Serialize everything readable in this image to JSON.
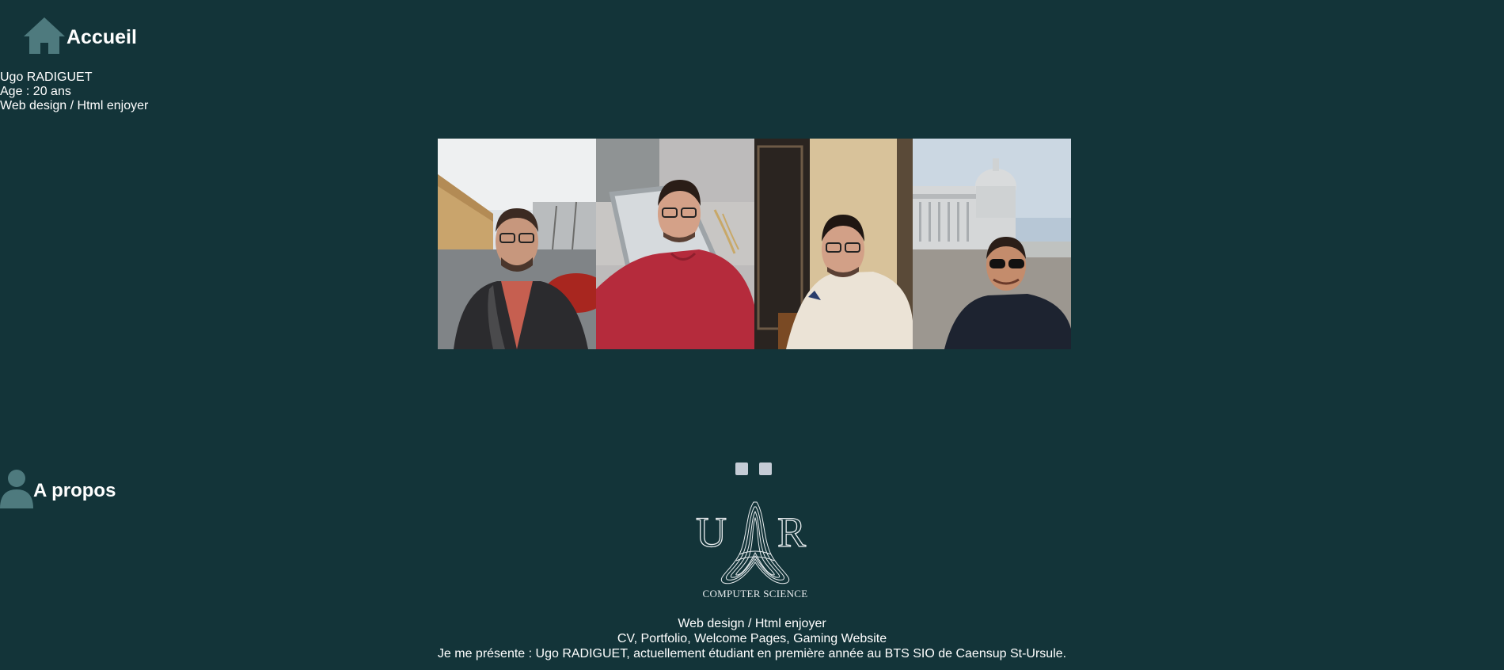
{
  "header": {
    "title": "Accueil",
    "icon": "home-icon"
  },
  "profile": {
    "name": "Ugo RADIGUET",
    "age": "Age : 20 ans",
    "tagline": "Web design / Html enjoyer"
  },
  "gallery": {
    "photos": [
      {
        "label": "selfie-parking"
      },
      {
        "label": "selfie-red-hoodie"
      },
      {
        "label": "selfie-white-sweater"
      },
      {
        "label": "selfie-capitol"
      }
    ]
  },
  "carousel": {
    "dot_count": 2
  },
  "about": {
    "title": "A propos",
    "icon": "user-icon"
  },
  "logo": {
    "letters_left": "U",
    "letters_right": "R",
    "caption": "COMPUTER SCIENCE"
  },
  "footer": {
    "line1": "Web design / Html enjoyer",
    "line2": "CV, Portfolio, Welcome Pages, Gaming Website",
    "line3": "Je me présente : Ugo RADIGUET, actuellement étudiant en première année au BTS SIO de Caensup St-Ursule."
  },
  "colors": {
    "background": "#133439",
    "icon": "#4e7a7e",
    "text": "#ffffff",
    "dot": "#c5ccd6"
  }
}
